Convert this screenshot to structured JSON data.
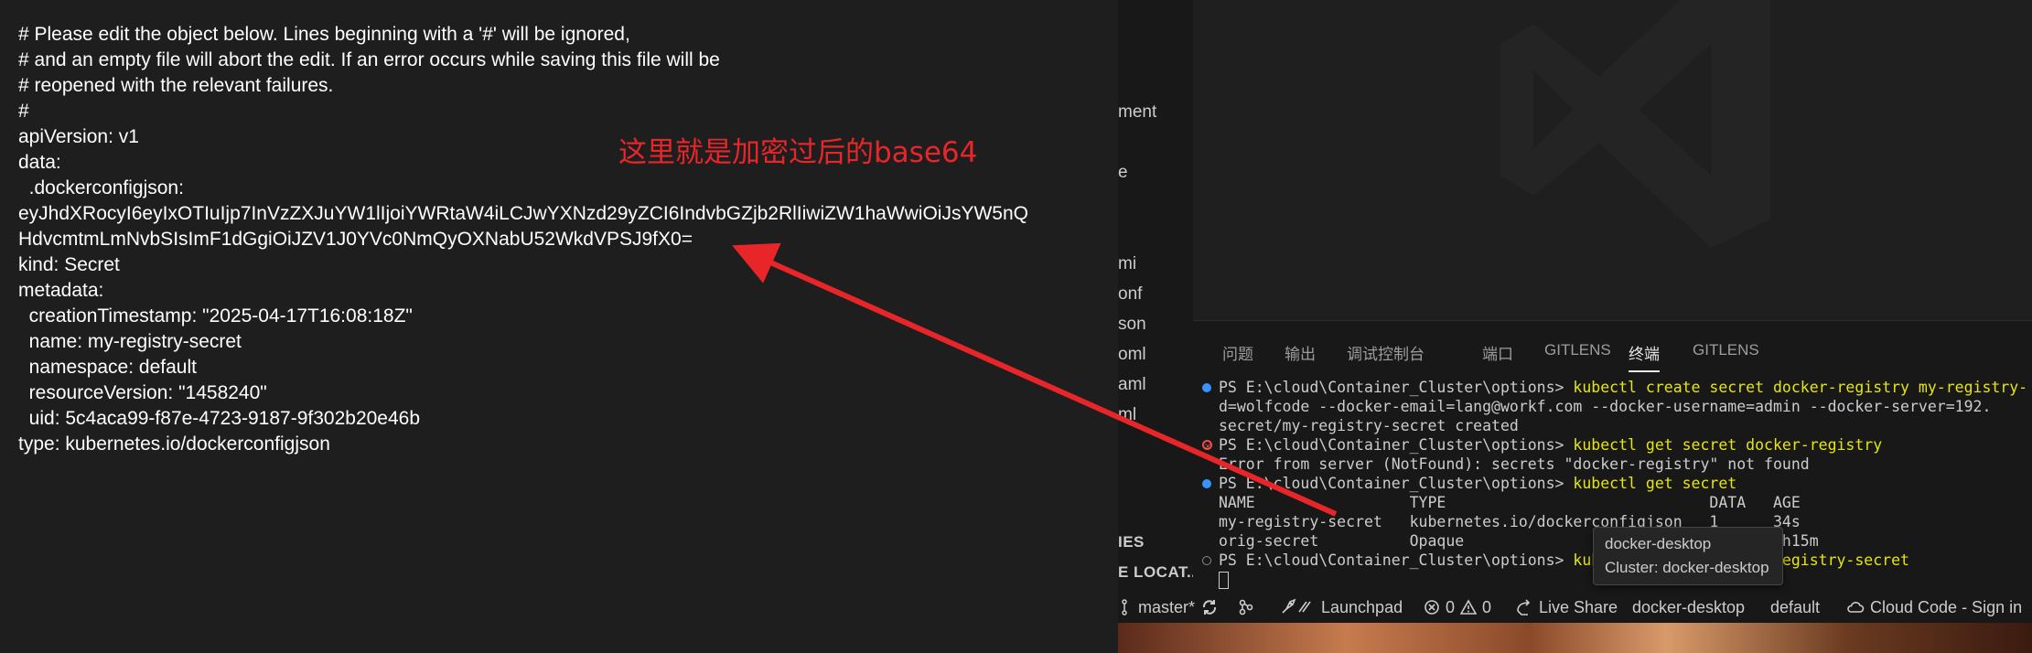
{
  "editor": {
    "lines": [
      "# Please edit the object below. Lines beginning with a '#' will be ignored,",
      "# and an empty file will abort the edit. If an error occurs while saving this file will be",
      "# reopened with the relevant failures.",
      "#",
      "apiVersion: v1",
      "data:",
      "  .dockerconfigjson:",
      "eyJhdXRocyI6eyIxOTIuIjp7InVzZXJuYW1lIjoiYWRtaW4iLCJwYXNzd29yZCI6IndvbGZjb2RlIiwiZW1haWwiOiJsYW5nQ",
      "HdvcmtmLmNvbSIsImF1dGgiOiJZV1J0YVc0NmQyOXNabU52WkdVPSJ9fX0=",
      "kind: Secret",
      "metadata:",
      "  creationTimestamp: \"2025-04-17T16:08:18Z\"",
      "  name: my-registry-secret",
      "  namespace: default",
      "  resourceVersion: \"1458240\"",
      "  uid: 5c4aca99-f87e-4723-9187-9f302b20e46b",
      "type: kubernetes.io/dockerconfigjson"
    ]
  },
  "annotation": {
    "text": "这里就是加密过后的base64",
    "color": "#e8262a"
  },
  "explorer": {
    "fragments": [
      "ment",
      "e",
      "mi",
      "onf",
      "son",
      "oml",
      "aml",
      "ml"
    ],
    "section_headers": [
      "IES",
      "E LOCAT..."
    ]
  },
  "panel": {
    "tabs": [
      {
        "label": "问题",
        "active": false
      },
      {
        "label": "输出",
        "active": false
      },
      {
        "label": "调试控制台",
        "active": false
      },
      {
        "label": "端口",
        "active": false
      },
      {
        "label": "GITLENS",
        "active": false
      },
      {
        "label": "终端",
        "active": true
      },
      {
        "label": "GITLENS",
        "active": false
      }
    ]
  },
  "terminal": {
    "lines": [
      {
        "marker": "blue",
        "prompt": "PS E:\\cloud\\Container_Cluster\\options> ",
        "cmd": "kubectl create secret docker-registry my-registry-"
      },
      {
        "marker": "",
        "prompt": "",
        "cmd": "",
        "text": "d=wolfcode --docker-email=lang@workf.com --docker-username=admin --docker-server=192."
      },
      {
        "marker": "",
        "prompt": "",
        "cmd": "",
        "text": "secret/my-registry-secret created"
      },
      {
        "marker": "err",
        "prompt": "PS E:\\cloud\\Container_Cluster\\options> ",
        "cmd": "kubectl get secret docker-registry"
      },
      {
        "marker": "",
        "prompt": "",
        "cmd": "",
        "text": "Error from server (NotFound): secrets \"docker-registry\" not found"
      },
      {
        "marker": "blue",
        "prompt": "PS E:\\cloud\\Container_Cluster\\options> ",
        "cmd": "kubectl get secret"
      },
      {
        "marker": "",
        "prompt": "",
        "cmd": "",
        "text": "NAME                 TYPE                             DATA   AGE"
      },
      {
        "marker": "",
        "prompt": "",
        "cmd": "",
        "text": "my-registry-secret   kubernetes.io/dockerconfigjson   1      34s"
      },
      {
        "marker": "",
        "prompt": "",
        "cmd": "",
        "text": "orig-secret          Opaque                           1      3h15m"
      },
      {
        "marker": "empty",
        "prompt": "PS E:\\cloud\\Container_Cluster\\options> ",
        "cmd": "kubectl get secret my-registry-secret"
      }
    ]
  },
  "tooltip": {
    "title": "docker-desktop",
    "detail": "Cluster: docker-desktop"
  },
  "statusbar": {
    "branch": "master*",
    "launchpad": "Launchpad",
    "errors": "0",
    "warnings": "0",
    "live_share": "Live Share",
    "context": "docker-desktop",
    "namespace": "default",
    "cloud_code": "Cloud Code - Sign in"
  },
  "colors": {
    "editor_bg": "#1e1e1e",
    "terminal_cmd": "#e5e510",
    "accent_blue": "#3794ff",
    "error_red": "#f14c4c"
  }
}
